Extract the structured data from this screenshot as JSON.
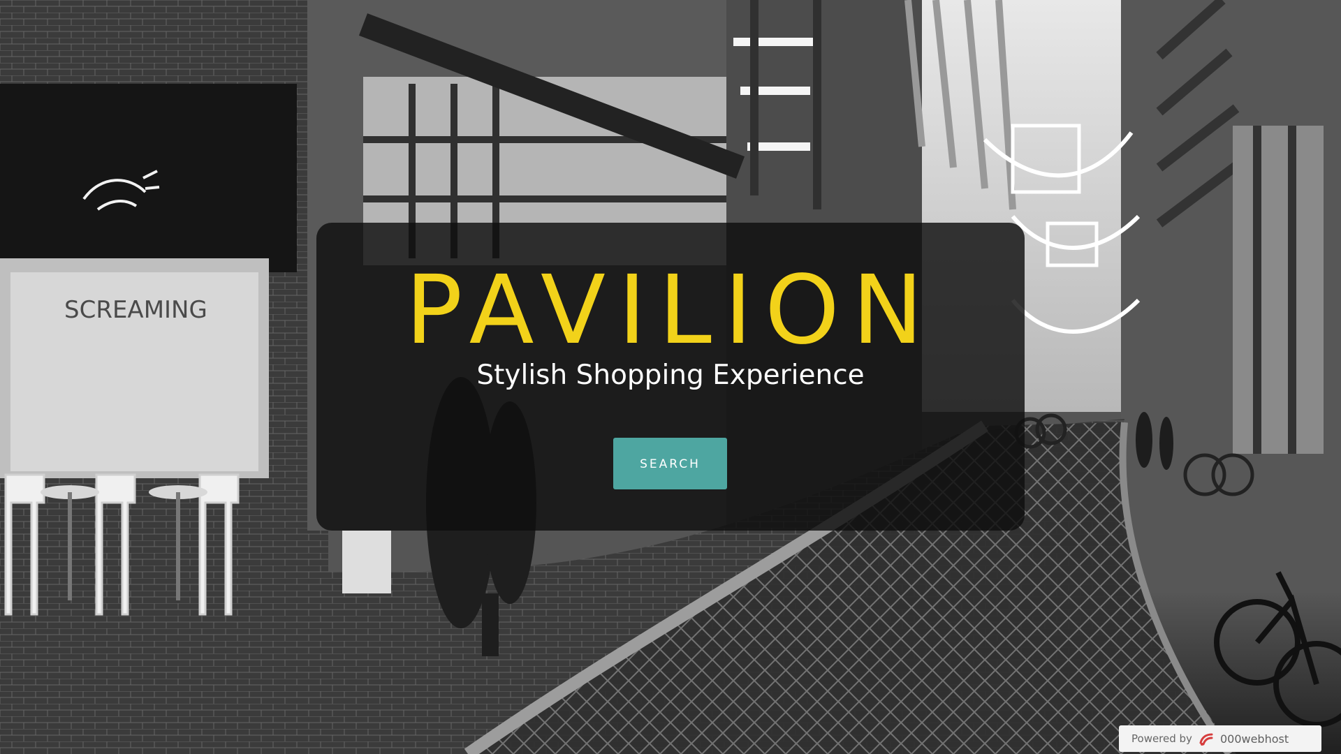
{
  "brand": {
    "title": "PAVILION",
    "tagline": "Stylish Shopping Experience"
  },
  "actions": {
    "search_label": "SEARCH"
  },
  "footer": {
    "powered_by": "Powered by",
    "provider": "000webhost"
  },
  "colors": {
    "title_color": "#f2d21a",
    "button_color": "#4ea6a1",
    "overlay_color": "#0f0f0f"
  }
}
